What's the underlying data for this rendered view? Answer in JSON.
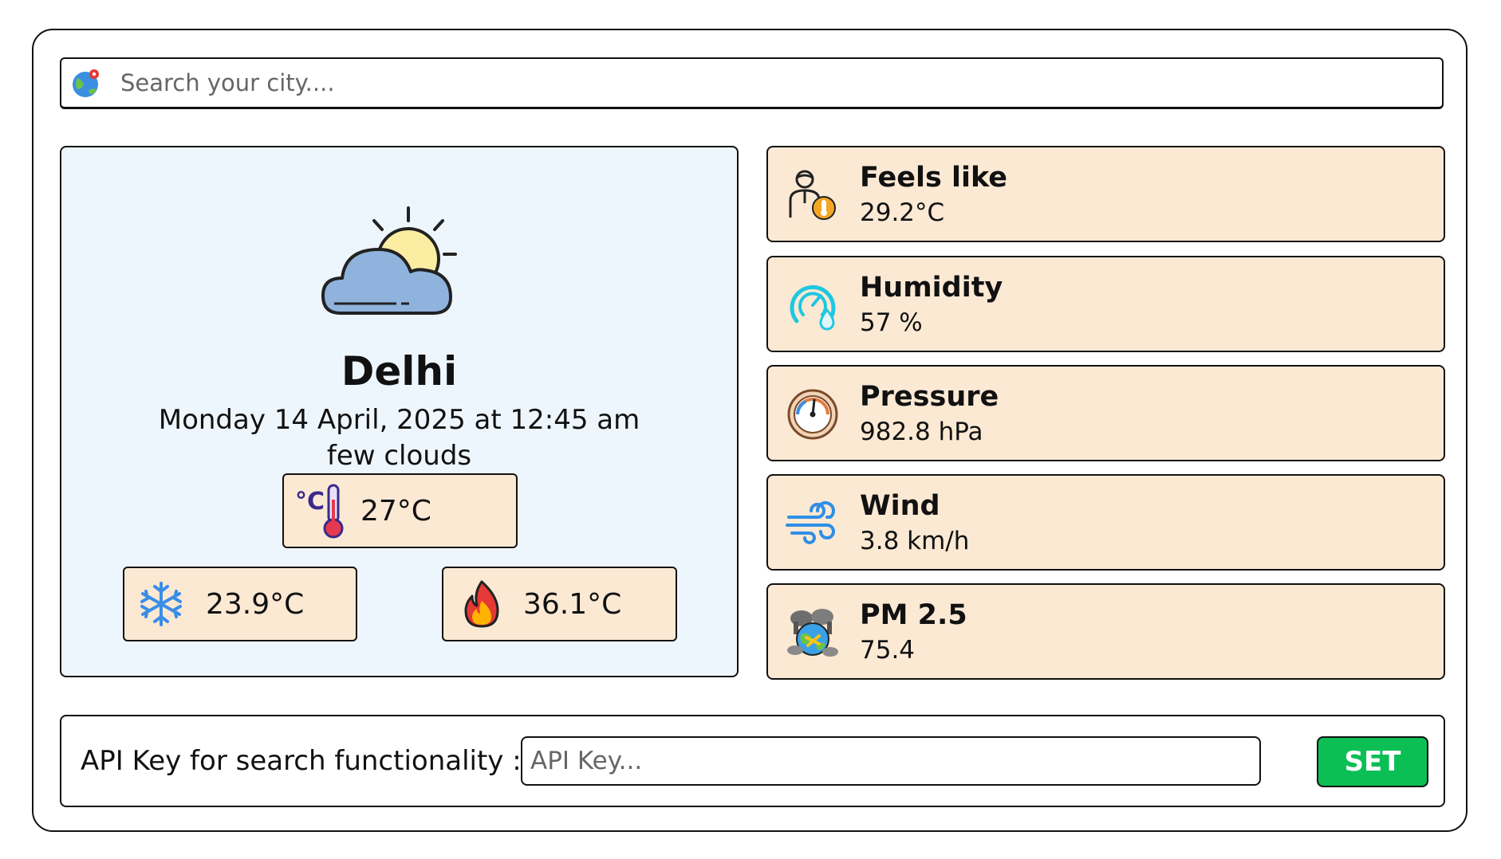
{
  "search": {
    "placeholder": "Search your city....",
    "icon": "globe-pin-icon"
  },
  "current": {
    "icon": "partly-cloudy-icon",
    "city": "Delhi",
    "datetime": "Monday 14 April, 2025 at 12:45 am",
    "condition": "few clouds",
    "temp": "27°C",
    "temp_icon": "celsius-thermometer-icon",
    "min_temp": "23.9°C",
    "min_icon": "snowflake-icon",
    "max_temp": "36.1°C",
    "max_icon": "fire-icon"
  },
  "stats": [
    {
      "label": "Feels like",
      "value": "29.2°C",
      "icon": "feels-like-person-icon"
    },
    {
      "label": "Humidity",
      "value": "57 %",
      "icon": "humidity-gauge-icon"
    },
    {
      "label": "Pressure",
      "value": "982.8 hPa",
      "icon": "pressure-gauge-icon"
    },
    {
      "label": "Wind",
      "value": "3.8 km/h",
      "icon": "wind-icon"
    },
    {
      "label": "PM 2.5",
      "value": "75.4",
      "icon": "polluted-earth-icon"
    }
  ],
  "api": {
    "label": "API Key for search functionality :",
    "placeholder": "API Key...",
    "button_label": "SET"
  },
  "colors": {
    "card_bg": "#fbe9d4",
    "main_bg": "#eef6fd",
    "button_green": "#0bbf55"
  }
}
